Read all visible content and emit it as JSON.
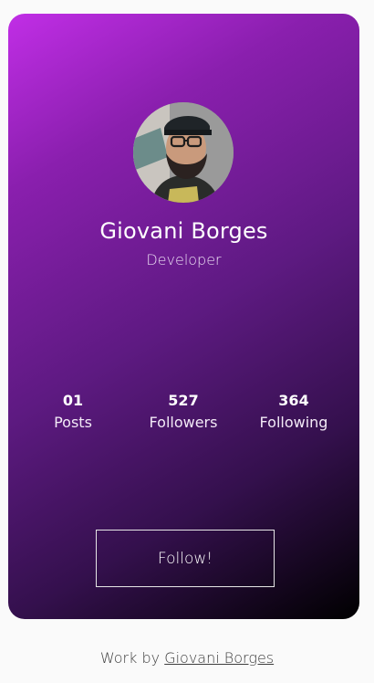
{
  "profile": {
    "name": "Giovani Borges",
    "role": "Developer"
  },
  "stats": [
    {
      "value": "01",
      "label": "Posts"
    },
    {
      "value": "527",
      "label": "Followers"
    },
    {
      "value": "364",
      "label": "Following"
    }
  ],
  "follow_button": {
    "label": "Follow!"
  },
  "footer": {
    "prefix": "Work by",
    "link_text": "Giovani Borges"
  },
  "colors": {
    "gradient_start": "#c12ee6",
    "gradient_mid": "#5e1a82",
    "gradient_end": "#000000"
  }
}
